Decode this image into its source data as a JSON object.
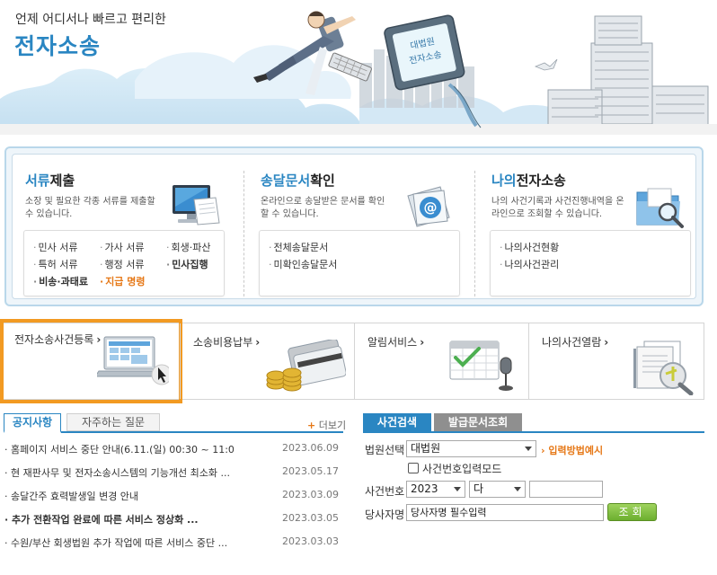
{
  "hero": {
    "tagline": "언제 어디서나 빠르고 편리한",
    "title": "전자소송",
    "monitor_text": "대법원 전자소송"
  },
  "services": [
    {
      "title_highlight": "서류",
      "title_rest": "제출",
      "desc": "소장 및 필요한 각종 서류를 제출할 수 있습니다.",
      "icon": "computer-document-icon",
      "links": [
        "민사 서류",
        "가사 서류",
        "회생·파산",
        "특허 서류",
        "행정 서류",
        "민사집행",
        "비송·과태료",
        "지급 명령"
      ]
    },
    {
      "title_highlight": "송달문서",
      "title_rest": "확인",
      "desc": "온라인으로 송달받은 문서를 확인 할 수 있습니다.",
      "icon": "email-envelope-icon",
      "links": [
        "전체송달문서",
        "미확인송달문서"
      ]
    },
    {
      "title_highlight": "나의",
      "title_rest": "전자소송",
      "desc": "나의 사건기록과 사건진행내역을 온라인으로 조회할 수 있습니다.",
      "icon": "folder-search-icon",
      "links": [
        "나의사건현황",
        "나의사건관리"
      ]
    }
  ],
  "shortcuts": [
    {
      "label": "전자소송사건등록",
      "icon": "laptop-cursor-icon"
    },
    {
      "label": "소송비용납부",
      "icon": "card-coins-icon"
    },
    {
      "label": "알림서비스",
      "icon": "calendar-microphone-icon"
    },
    {
      "label": "나의사건열람",
      "icon": "documents-magnifier-icon"
    }
  ],
  "notices": {
    "tabs": [
      "공지사항",
      "자주하는 질문"
    ],
    "more": "더보기",
    "items": [
      {
        "title": "홈페이지 서비스 중단 안내(6.11.(일) 00:30 ~ 11:0...",
        "date": "2023.06.09"
      },
      {
        "title": "현 재판사무 및 전자소송시스템의 기능개선 최소화 ...",
        "date": "2023.05.17"
      },
      {
        "title": "송달간주 효력발생일 변경 안내",
        "date": "2023.03.09"
      },
      {
        "title": "추가 전환작업 완료에 따른 서비스 정상화 ...",
        "date": "2023.03.05"
      },
      {
        "title": "수원/부산 회생법원 추가 작업에 따른 서비스 중단 ...",
        "date": "2023.03.03"
      }
    ]
  },
  "case_search": {
    "tabs": [
      "사건검색",
      "발급문서조회"
    ],
    "court_label": "법원선택",
    "court_value": "대법원",
    "input_guide": "입력방법예시",
    "case_mode_label": "사건번호입력모드",
    "case_no_label": "사건번호",
    "year_value": "2023",
    "type_value": "다",
    "party_label": "당사자명",
    "party_placeholder": "당사자명 필수입력",
    "search_button": "조회"
  },
  "colors": {
    "accent": "#2a86c2",
    "highlight": "#e67817",
    "active_border": "#f29a22",
    "search_button": "#7bbf3a"
  }
}
